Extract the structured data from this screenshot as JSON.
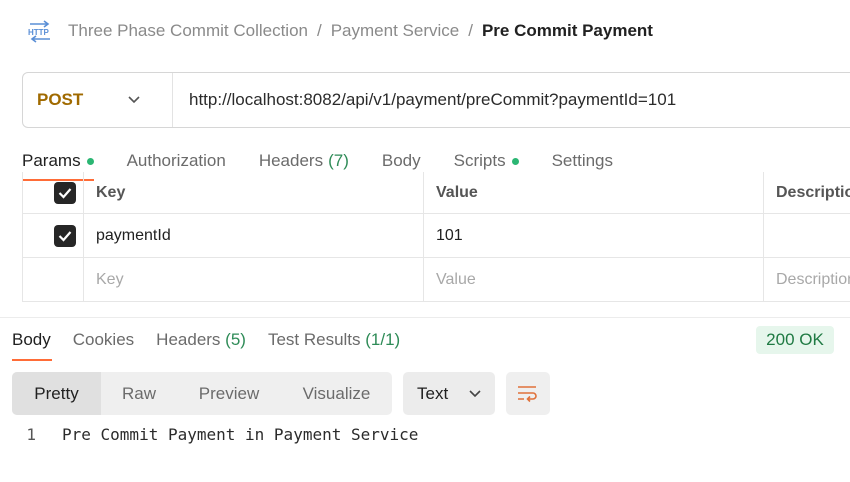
{
  "breadcrumb": {
    "icon": "http-icon",
    "items": [
      "Three Phase Commit Collection",
      "Payment Service"
    ],
    "separator": "/",
    "current": "Pre Commit Payment"
  },
  "request": {
    "method": "POST",
    "url": "http://localhost:8082/api/v1/payment/preCommit?paymentId=101"
  },
  "request_tabs": {
    "params": "Params",
    "authorization": "Authorization",
    "headers": "Headers",
    "headers_count": "(7)",
    "body": "Body",
    "scripts": "Scripts",
    "settings": "Settings",
    "active": "Params"
  },
  "params_table": {
    "headers": {
      "key": "Key",
      "value": "Value",
      "description": "Description"
    },
    "rows": [
      {
        "checked": true,
        "key": "paymentId",
        "value": "101",
        "description": ""
      }
    ],
    "placeholder": {
      "key": "Key",
      "value": "Value",
      "description": "Description"
    }
  },
  "response_tabs": {
    "body": "Body",
    "cookies": "Cookies",
    "headers": "Headers ",
    "headers_count": "(5)",
    "test_results": "Test Results ",
    "test_results_count": "(1/1)",
    "active": "Body"
  },
  "status": {
    "text": "200 OK",
    "color": "#1f7a43"
  },
  "response_view": {
    "modes": [
      "Pretty",
      "Raw",
      "Preview",
      "Visualize"
    ],
    "active": "Pretty",
    "format": "Text"
  },
  "response_body": [
    {
      "line": "1",
      "text": "Pre Commit Payment in Payment Service"
    }
  ],
  "colors": {
    "accent": "#ff6c37",
    "method": "#a06a00",
    "dot": "#2bb673"
  }
}
